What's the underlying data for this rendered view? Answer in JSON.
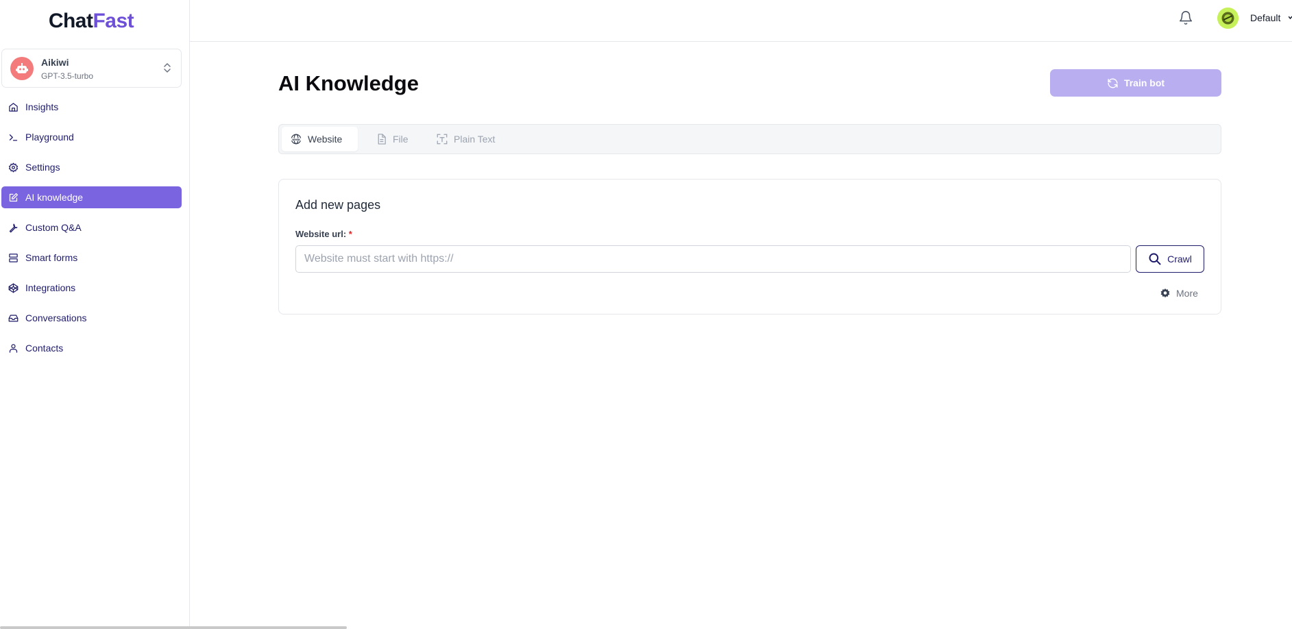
{
  "brand": {
    "part1": "Chat",
    "part2": "Fast"
  },
  "bot": {
    "name": "Aikiwi",
    "model": "GPT-3.5-turbo",
    "avatar_icon": "robot-icon"
  },
  "nav": {
    "items": [
      {
        "label": "Insights",
        "icon": "home-icon",
        "active": false
      },
      {
        "label": "Playground",
        "icon": "terminal-icon",
        "active": false
      },
      {
        "label": "Settings",
        "icon": "gear-icon",
        "active": false
      },
      {
        "label": "AI knowledge",
        "icon": "edit-icon",
        "active": true
      },
      {
        "label": "Custom Q&A",
        "icon": "wrench-icon",
        "active": false
      },
      {
        "label": "Smart forms",
        "icon": "server-icon",
        "active": false
      },
      {
        "label": "Integrations",
        "icon": "codepen-icon",
        "active": false
      },
      {
        "label": "Conversations",
        "icon": "inbox-icon",
        "active": false
      },
      {
        "label": "Contacts",
        "icon": "user-icon",
        "active": false
      }
    ]
  },
  "topbar": {
    "workspace": "Default"
  },
  "page": {
    "title": "AI Knowledge",
    "train_button": "Train bot"
  },
  "tabs": [
    {
      "label": "Website",
      "icon": "globe-www-icon",
      "active": true
    },
    {
      "label": "File",
      "icon": "file-icon",
      "active": false
    },
    {
      "label": "Plain Text",
      "icon": "text-select-icon",
      "active": false
    }
  ],
  "form": {
    "title": "Add new pages",
    "url_label": "Website url:",
    "required_mark": "*",
    "url_value": "",
    "url_placeholder": "Website must start with https://",
    "crawl_button": "Crawl",
    "more_label": "More"
  },
  "colors": {
    "accent": "#7b64e0",
    "brand": "#6d4fd8",
    "train_button_bg": "#b9aff0",
    "nav_text": "#1e1b6b"
  }
}
